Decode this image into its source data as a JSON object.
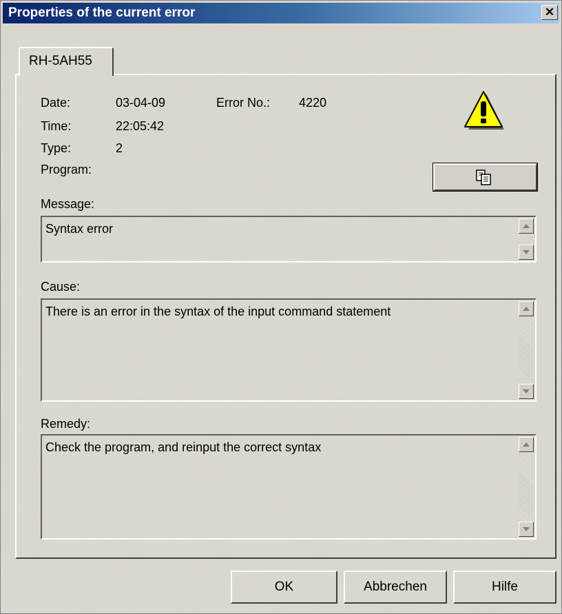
{
  "window": {
    "title": "Properties of the current error",
    "close_symbol": "✕"
  },
  "tab": {
    "label": "RH-5AH55"
  },
  "fields": {
    "date_label": "Date:",
    "date_value": "03-04-09",
    "error_no_label": "Error No.:",
    "error_no_value": "4220",
    "time_label": "Time:",
    "time_value": "22:05:42",
    "type_label": "Type:",
    "type_value": "2",
    "program_label": "Program:"
  },
  "message": {
    "label": "Message:",
    "text": "Syntax error"
  },
  "cause": {
    "label": "Cause:",
    "text": "There is an error in the syntax of the input command statement"
  },
  "remedy": {
    "label": "Remedy:",
    "text": "Check the program, and reinput the correct syntax"
  },
  "buttons": {
    "ok": "OK",
    "cancel": "Abbrechen",
    "help": "Hilfe"
  },
  "colors": {
    "title_start": "#0a246a",
    "title_end": "#a6caf0",
    "warning_yellow": "#ffff00"
  },
  "icons": {
    "warning": "warning-icon",
    "copy": "copy-icon",
    "close": "close-icon"
  }
}
